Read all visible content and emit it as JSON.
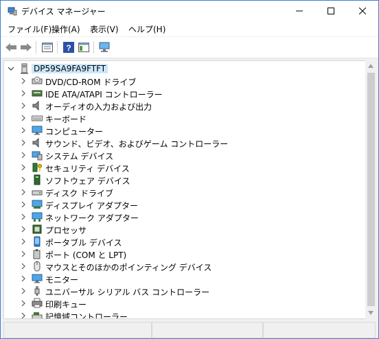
{
  "window": {
    "title": "デバイス マネージャー",
    "icon_name": "device-manager-icon"
  },
  "menu": [
    {
      "label": "ファイル(F)"
    },
    {
      "label": "操作(A)"
    },
    {
      "label": "表示(V)"
    },
    {
      "label": "ヘルプ(H)"
    }
  ],
  "toolbar": [
    {
      "icon": "back-arrow-icon"
    },
    {
      "icon": "forward-arrow-icon"
    },
    {
      "icon": "properties-icon"
    },
    {
      "icon": "help-icon"
    },
    {
      "icon": "show-hide-console-tree-icon"
    },
    {
      "icon": "scan-hardware-icon"
    }
  ],
  "tree": {
    "root": {
      "label": "DP59SA9FA9FTFT",
      "expanded": true,
      "icon": "computer-icon"
    },
    "items": [
      {
        "label": "DVD/CD-ROM ドライブ",
        "icon": "dvd-drive-icon"
      },
      {
        "label": "IDE ATA/ATAPI コントローラー",
        "icon": "ide-controller-icon"
      },
      {
        "label": "オーディオの入力および出力",
        "icon": "speaker-icon"
      },
      {
        "label": "キーボード",
        "icon": "keyboard-icon"
      },
      {
        "label": "コンピューター",
        "icon": "monitor-icon"
      },
      {
        "label": "サウンド、ビデオ、およびゲーム コントローラー",
        "icon": "speaker-icon"
      },
      {
        "label": "システム デバイス",
        "icon": "system-device-icon"
      },
      {
        "label": "セキュリティ デバイス",
        "icon": "security-key-icon"
      },
      {
        "label": "ソフトウェア デバイス",
        "icon": "software-device-icon"
      },
      {
        "label": "ディスク ドライブ",
        "icon": "disk-drive-icon"
      },
      {
        "label": "ディスプレイ アダプター",
        "icon": "display-adapter-icon"
      },
      {
        "label": "ネットワーク アダプター",
        "icon": "network-adapter-icon"
      },
      {
        "label": "プロセッサ",
        "icon": "processor-icon"
      },
      {
        "label": "ポータブル デバイス",
        "icon": "portable-device-icon"
      },
      {
        "label": "ポート (COM と LPT)",
        "icon": "port-icon"
      },
      {
        "label": "マウスとそのほかのポインティング デバイス",
        "icon": "mouse-icon"
      },
      {
        "label": "モニター",
        "icon": "monitor-icon"
      },
      {
        "label": "ユニバーサル シリアル バス コントローラー",
        "icon": "usb-icon"
      },
      {
        "label": "印刷キュー",
        "icon": "printer-icon"
      },
      {
        "label": "記憶域コントローラー",
        "icon": "storage-controller-icon"
      }
    ]
  },
  "colors": {
    "selection": "#cce8ff",
    "accent": "#3b7fd6"
  }
}
